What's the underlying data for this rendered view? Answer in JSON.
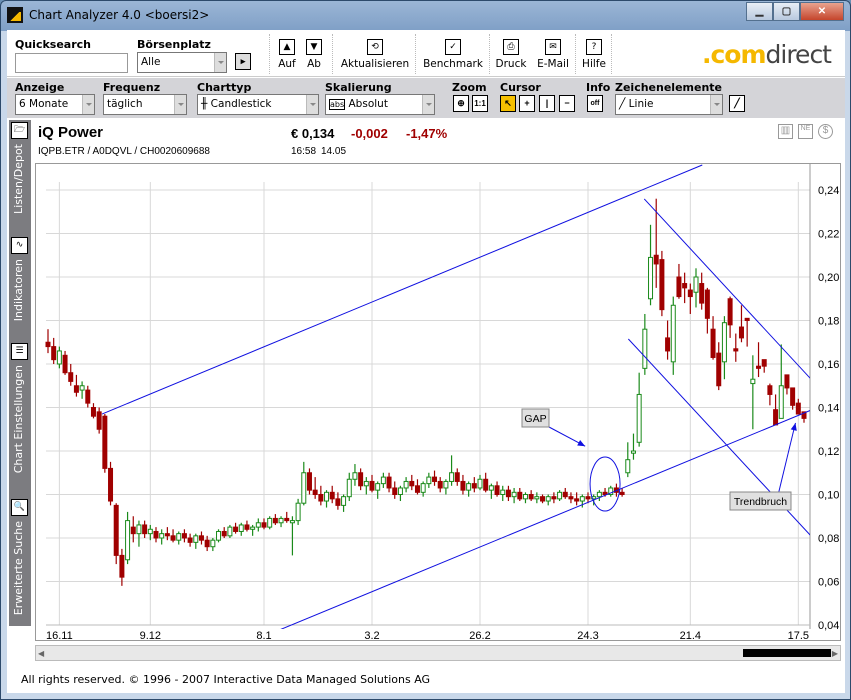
{
  "window": {
    "title": "Chart Analyzer 4.0  <boersi2>",
    "buttons": [
      "minimize",
      "maximize",
      "close"
    ]
  },
  "toolbar": {
    "quicksearch_label": "Quicksearch",
    "quicksearch_value": "",
    "boersenplatz_label": "Börsenplatz",
    "boersenplatz_value": "Alle",
    "auf": "Auf",
    "ab": "Ab",
    "aktualisieren": "Aktualisieren",
    "benchmark": "Benchmark",
    "druck": "Druck",
    "email": "E-Mail",
    "hilfe": "Hilfe",
    "brand_prefix": ".com",
    "brand_suffix": "direct"
  },
  "settings": {
    "anzeige_label": "Anzeige",
    "anzeige_value": "6 Monate",
    "frequenz_label": "Frequenz",
    "frequenz_value": "täglich",
    "charttyp_label": "Charttyp",
    "charttyp_value": "Candlestick",
    "skalierung_label": "Skalierung",
    "skalierung_value": "Absolut",
    "skalierung_icon": "abs",
    "zoom_label": "Zoom",
    "zoom_reset": "1:1",
    "cursor_label": "Cursor",
    "info_label": "Info",
    "info_value": "off",
    "zeichen_label": "Zeichenelemente",
    "zeichen_value": "Linie"
  },
  "sidebar": {
    "items": [
      {
        "label": "Listen/Depot"
      },
      {
        "label": "Indikatoren"
      },
      {
        "label": "Chart Einstellungen"
      },
      {
        "label": "Erweiterte Suche"
      }
    ]
  },
  "instrument": {
    "name": "iQ Power",
    "ids": "IQPB.ETR  /  A0DQVL  /  CH0020609688",
    "price": "€ 0,134",
    "change": "-0,002",
    "change_pct": "-1,47%",
    "time": "16:58",
    "date": "14.05"
  },
  "colors": {
    "up": "#1a8a1a",
    "down": "#a00000",
    "lines": "#1010e0",
    "grid": "#d8d8d8"
  },
  "chart_data": {
    "type": "candlestick",
    "ylim": [
      0.04,
      0.24
    ],
    "yticks": [
      "0,24",
      "0,22",
      "0,20",
      "0,18",
      "0,16",
      "0,14",
      "0,12",
      "0,10",
      "0,08",
      "0,06",
      "0,04"
    ],
    "xticks": [
      {
        "label": "16.11",
        "index": 2
      },
      {
        "label": "9.12",
        "index": 18
      },
      {
        "label": "8.1",
        "index": 38
      },
      {
        "label": "3.2",
        "index": 57
      },
      {
        "label": "26.2",
        "index": 76
      },
      {
        "label": "24.3",
        "index": 95
      },
      {
        "label": "21.4",
        "index": 113
      },
      {
        "label": "17.5",
        "index": 132
      }
    ],
    "candles_ohlc": [
      [
        0.17,
        0.176,
        0.165,
        0.168
      ],
      [
        0.168,
        0.172,
        0.16,
        0.162
      ],
      [
        0.16,
        0.168,
        0.158,
        0.166
      ],
      [
        0.164,
        0.166,
        0.155,
        0.156
      ],
      [
        0.156,
        0.16,
        0.15,
        0.152
      ],
      [
        0.15,
        0.155,
        0.145,
        0.147
      ],
      [
        0.148,
        0.152,
        0.144,
        0.15
      ],
      [
        0.148,
        0.15,
        0.14,
        0.142
      ],
      [
        0.14,
        0.142,
        0.135,
        0.136
      ],
      [
        0.138,
        0.14,
        0.128,
        0.13
      ],
      [
        0.136,
        0.137,
        0.11,
        0.112
      ],
      [
        0.112,
        0.115,
        0.095,
        0.097
      ],
      [
        0.095,
        0.096,
        0.068,
        0.072
      ],
      [
        0.072,
        0.075,
        0.058,
        0.062
      ],
      [
        0.07,
        0.092,
        0.068,
        0.088
      ],
      [
        0.085,
        0.09,
        0.078,
        0.082
      ],
      [
        0.082,
        0.088,
        0.076,
        0.086
      ],
      [
        0.086,
        0.088,
        0.08,
        0.082
      ],
      [
        0.082,
        0.086,
        0.079,
        0.084
      ],
      [
        0.083,
        0.085,
        0.078,
        0.08
      ],
      [
        0.08,
        0.084,
        0.077,
        0.082
      ],
      [
        0.082,
        0.085,
        0.079,
        0.081
      ],
      [
        0.081,
        0.084,
        0.078,
        0.079
      ],
      [
        0.079,
        0.083,
        0.077,
        0.082
      ],
      [
        0.082,
        0.084,
        0.078,
        0.08
      ],
      [
        0.08,
        0.082,
        0.076,
        0.078
      ],
      [
        0.078,
        0.082,
        0.075,
        0.081
      ],
      [
        0.081,
        0.083,
        0.077,
        0.079
      ],
      [
        0.079,
        0.081,
        0.074,
        0.076
      ],
      [
        0.076,
        0.08,
        0.074,
        0.079
      ],
      [
        0.079,
        0.084,
        0.078,
        0.083
      ],
      [
        0.083,
        0.085,
        0.08,
        0.081
      ],
      [
        0.081,
        0.086,
        0.08,
        0.085
      ],
      [
        0.085,
        0.087,
        0.082,
        0.083
      ],
      [
        0.083,
        0.087,
        0.081,
        0.086
      ],
      [
        0.086,
        0.088,
        0.083,
        0.084
      ],
      [
        0.084,
        0.086,
        0.081,
        0.085
      ],
      [
        0.085,
        0.089,
        0.083,
        0.087
      ],
      [
        0.087,
        0.089,
        0.084,
        0.085
      ],
      [
        0.085,
        0.09,
        0.084,
        0.089
      ],
      [
        0.089,
        0.091,
        0.086,
        0.087
      ],
      [
        0.087,
        0.09,
        0.085,
        0.089
      ],
      [
        0.089,
        0.092,
        0.087,
        0.088
      ],
      [
        0.087,
        0.09,
        0.072,
        0.088
      ],
      [
        0.088,
        0.098,
        0.086,
        0.096
      ],
      [
        0.096,
        0.115,
        0.095,
        0.11
      ],
      [
        0.11,
        0.112,
        0.1,
        0.102
      ],
      [
        0.102,
        0.108,
        0.098,
        0.1
      ],
      [
        0.1,
        0.104,
        0.095,
        0.097
      ],
      [
        0.097,
        0.102,
        0.094,
        0.101
      ],
      [
        0.101,
        0.104,
        0.096,
        0.098
      ],
      [
        0.098,
        0.101,
        0.093,
        0.095
      ],
      [
        0.095,
        0.1,
        0.092,
        0.099
      ],
      [
        0.099,
        0.11,
        0.097,
        0.107
      ],
      [
        0.107,
        0.114,
        0.104,
        0.11
      ],
      [
        0.11,
        0.112,
        0.102,
        0.104
      ],
      [
        0.104,
        0.108,
        0.1,
        0.106
      ],
      [
        0.106,
        0.109,
        0.101,
        0.102
      ],
      [
        0.102,
        0.106,
        0.098,
        0.105
      ],
      [
        0.105,
        0.11,
        0.103,
        0.108
      ],
      [
        0.108,
        0.11,
        0.101,
        0.103
      ],
      [
        0.103,
        0.106,
        0.098,
        0.1
      ],
      [
        0.1,
        0.104,
        0.097,
        0.103
      ],
      [
        0.103,
        0.108,
        0.101,
        0.106
      ],
      [
        0.106,
        0.109,
        0.102,
        0.104
      ],
      [
        0.104,
        0.107,
        0.1,
        0.101
      ],
      [
        0.101,
        0.106,
        0.099,
        0.105
      ],
      [
        0.105,
        0.11,
        0.103,
        0.108
      ],
      [
        0.108,
        0.111,
        0.104,
        0.106
      ],
      [
        0.106,
        0.108,
        0.101,
        0.103
      ],
      [
        0.103,
        0.107,
        0.1,
        0.106
      ],
      [
        0.106,
        0.118,
        0.104,
        0.11
      ],
      [
        0.11,
        0.112,
        0.104,
        0.106
      ],
      [
        0.106,
        0.109,
        0.1,
        0.102
      ],
      [
        0.102,
        0.106,
        0.099,
        0.105
      ],
      [
        0.105,
        0.108,
        0.101,
        0.103
      ],
      [
        0.103,
        0.109,
        0.102,
        0.107
      ],
      [
        0.107,
        0.11,
        0.101,
        0.102
      ],
      [
        0.102,
        0.105,
        0.098,
        0.104
      ],
      [
        0.104,
        0.106,
        0.099,
        0.1
      ],
      [
        0.1,
        0.104,
        0.097,
        0.102
      ],
      [
        0.102,
        0.104,
        0.097,
        0.099
      ],
      [
        0.099,
        0.103,
        0.096,
        0.101
      ],
      [
        0.101,
        0.103,
        0.097,
        0.098
      ],
      [
        0.098,
        0.101,
        0.096,
        0.1
      ],
      [
        0.1,
        0.102,
        0.097,
        0.098
      ],
      [
        0.098,
        0.101,
        0.096,
        0.099
      ],
      [
        0.099,
        0.1,
        0.096,
        0.097
      ],
      [
        0.097,
        0.1,
        0.095,
        0.099
      ],
      [
        0.099,
        0.101,
        0.096,
        0.098
      ],
      [
        0.098,
        0.102,
        0.097,
        0.101
      ],
      [
        0.101,
        0.103,
        0.098,
        0.099
      ],
      [
        0.099,
        0.101,
        0.096,
        0.098
      ],
      [
        0.098,
        0.101,
        0.095,
        0.097
      ],
      [
        0.097,
        0.1,
        0.094,
        0.099
      ],
      [
        0.099,
        0.101,
        0.096,
        0.098
      ],
      [
        0.098,
        0.1,
        0.095,
        0.099
      ],
      [
        0.099,
        0.102,
        0.097,
        0.101
      ],
      [
        0.101,
        0.103,
        0.099,
        0.1
      ],
      [
        0.1,
        0.104,
        0.099,
        0.103
      ],
      [
        0.103,
        0.105,
        0.099,
        0.101
      ],
      [
        0.101,
        0.103,
        0.099,
        0.1
      ],
      [
        0.11,
        0.124,
        0.108,
        0.116
      ],
      [
        0.119,
        0.128,
        0.116,
        0.12
      ],
      [
        0.124,
        0.156,
        0.122,
        0.146
      ],
      [
        0.158,
        0.183,
        0.155,
        0.176
      ],
      [
        0.19,
        0.224,
        0.187,
        0.209
      ],
      [
        0.21,
        0.236,
        0.195,
        0.206
      ],
      [
        0.208,
        0.212,
        0.182,
        0.185
      ],
      [
        0.172,
        0.18,
        0.162,
        0.166
      ],
      [
        0.161,
        0.191,
        0.155,
        0.187
      ],
      [
        0.2,
        0.206,
        0.19,
        0.191
      ],
      [
        0.197,
        0.202,
        0.188,
        0.195
      ],
      [
        0.194,
        0.197,
        0.183,
        0.191
      ],
      [
        0.193,
        0.204,
        0.186,
        0.2
      ],
      [
        0.197,
        0.202,
        0.185,
        0.188
      ],
      [
        0.194,
        0.195,
        0.174,
        0.181
      ],
      [
        0.176,
        0.182,
        0.162,
        0.163
      ],
      [
        0.165,
        0.17,
        0.148,
        0.15
      ],
      [
        0.161,
        0.182,
        0.153,
        0.179
      ],
      [
        0.19,
        0.191,
        0.172,
        0.178
      ],
      [
        0.167,
        0.174,
        0.161,
        0.166
      ],
      [
        0.177,
        0.187,
        0.17,
        0.172
      ],
      [
        0.181,
        0.181,
        0.168,
        0.18
      ],
      [
        0.151,
        0.164,
        0.13,
        0.153
      ],
      [
        0.159,
        0.17,
        0.154,
        0.158
      ],
      [
        0.162,
        0.162,
        0.156,
        0.159
      ],
      [
        0.15,
        0.151,
        0.141,
        0.146
      ],
      [
        0.139,
        0.146,
        0.132,
        0.132
      ],
      [
        0.135,
        0.169,
        0.135,
        0.15
      ],
      [
        0.155,
        0.155,
        0.146,
        0.149
      ],
      [
        0.149,
        0.149,
        0.139,
        0.141
      ],
      [
        0.142,
        0.144,
        0.137,
        0.137
      ],
      [
        0.138,
        0.138,
        0.133,
        0.135
      ]
    ],
    "trendlines": [
      {
        "name": "upper-channel",
        "from": [
          9.5,
          0.137
        ],
        "to": [
          115.1,
          0.2515
        ]
      },
      {
        "name": "lower-channel",
        "from": [
          35.6,
          0.0322
        ],
        "to": [
          139.8,
          0.1448
        ]
      },
      {
        "name": "falling-upper",
        "from": [
          104.9,
          0.2359
        ],
        "to": [
          135.2,
          0.1503
        ]
      },
      {
        "name": "falling-lower",
        "from": [
          102.1,
          0.1715
        ],
        "to": [
          134.7,
          0.0796
        ]
      }
    ],
    "annotations": [
      {
        "text": "GAP",
        "target": [
          94.5,
          0.1222
        ]
      },
      {
        "text": "Trendbruch",
        "target": [
          131.5,
          0.1329
        ]
      }
    ],
    "gap_marker": {
      "center": [
        98,
        0.1048
      ]
    }
  },
  "footer": {
    "copyright": "All rights reserved. © 1996 - 2007 Interactive Data Managed Solutions AG"
  }
}
